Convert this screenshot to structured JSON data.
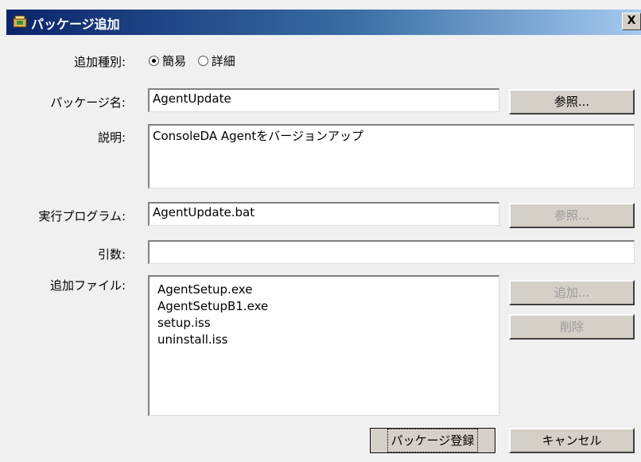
{
  "window": {
    "title": "パッケージ追加",
    "close_glyph": "X"
  },
  "form": {
    "type_label": "追加種別:",
    "type_options": [
      {
        "label": "簡易",
        "selected": true
      },
      {
        "label": "詳細",
        "selected": false
      }
    ],
    "package_name_label": "パッケージ名:",
    "package_name_value": "AgentUpdate",
    "description_label": "説明:",
    "description_value": "ConsoleDA Agentをバージョンアップ",
    "program_label": "実行プログラム:",
    "program_value": "AgentUpdate.bat",
    "args_label": "引数:",
    "args_value": "",
    "files_label": "追加ファイル:",
    "files": [
      "AgentSetup.exe",
      "AgentSetupB1.exe",
      "setup.iss",
      "uninstall.iss"
    ]
  },
  "buttons": {
    "browse_package": "参照...",
    "browse_program": "参照...",
    "add_file": "追加...",
    "delete_file": "削除",
    "register": "パッケージ登録",
    "cancel": "キャンセル"
  }
}
